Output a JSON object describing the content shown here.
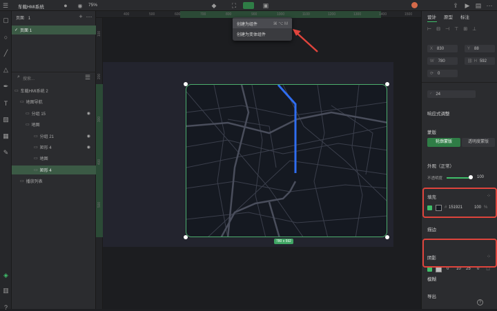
{
  "topbar": {
    "title": "车载HMI系统",
    "zoom": "75%"
  },
  "menu": {
    "item1": "创建为组件",
    "item1_shortcut": "⌘ ⌥ M",
    "item2": "创建为变体组件"
  },
  "pages": {
    "label": "页面",
    "count": "1",
    "page1": "页面 1"
  },
  "search": {
    "placeholder": "搜索..."
  },
  "layers": [
    {
      "label": "车载HMI系统 2",
      "indent": 4
    },
    {
      "label": "地图导航",
      "indent": 12
    },
    {
      "label": "分组 15",
      "indent": 20
    },
    {
      "label": "地图",
      "indent": 20
    },
    {
      "label": "分组 21",
      "indent": 32
    },
    {
      "label": "矩形 4",
      "indent": 32
    },
    {
      "label": "地图",
      "indent": 32
    },
    {
      "label": "矩形 4",
      "indent": 32
    },
    {
      "label": "播放列表",
      "indent": 12
    }
  ],
  "ruler": {
    "h": [
      "400",
      "500",
      "600",
      "700",
      "800",
      "900",
      "1000",
      "1100",
      "1200",
      "1300",
      "1400",
      "1500"
    ],
    "v": [
      "100",
      "200",
      "300",
      "400",
      "500"
    ]
  },
  "size_badge": "780 x 592",
  "right": {
    "tabs": [
      "设计",
      "原型",
      "标注"
    ],
    "x_label": "X",
    "x": "830",
    "y_label": "Y",
    "y": "88",
    "w_label": "W",
    "w": "780",
    "h_label": "H",
    "h": "592",
    "rot": "0",
    "radius": "24",
    "responsive": "响应式调整",
    "layout": "蒙版",
    "layout_a": "轮廓蒙版",
    "layout_b": "透明度蒙版",
    "appearance": "外观（正常）",
    "opacity_label": "不透明度",
    "opacity": "100",
    "fill": "填充",
    "fill_hex": "151921",
    "fill_pct": "100",
    "fill_unit": "%",
    "stroke": "描边",
    "shadow": "阴影",
    "shadow_vals": [
      "0",
      "10",
      "25",
      "0"
    ],
    "blur": "模糊",
    "export": "导出"
  }
}
